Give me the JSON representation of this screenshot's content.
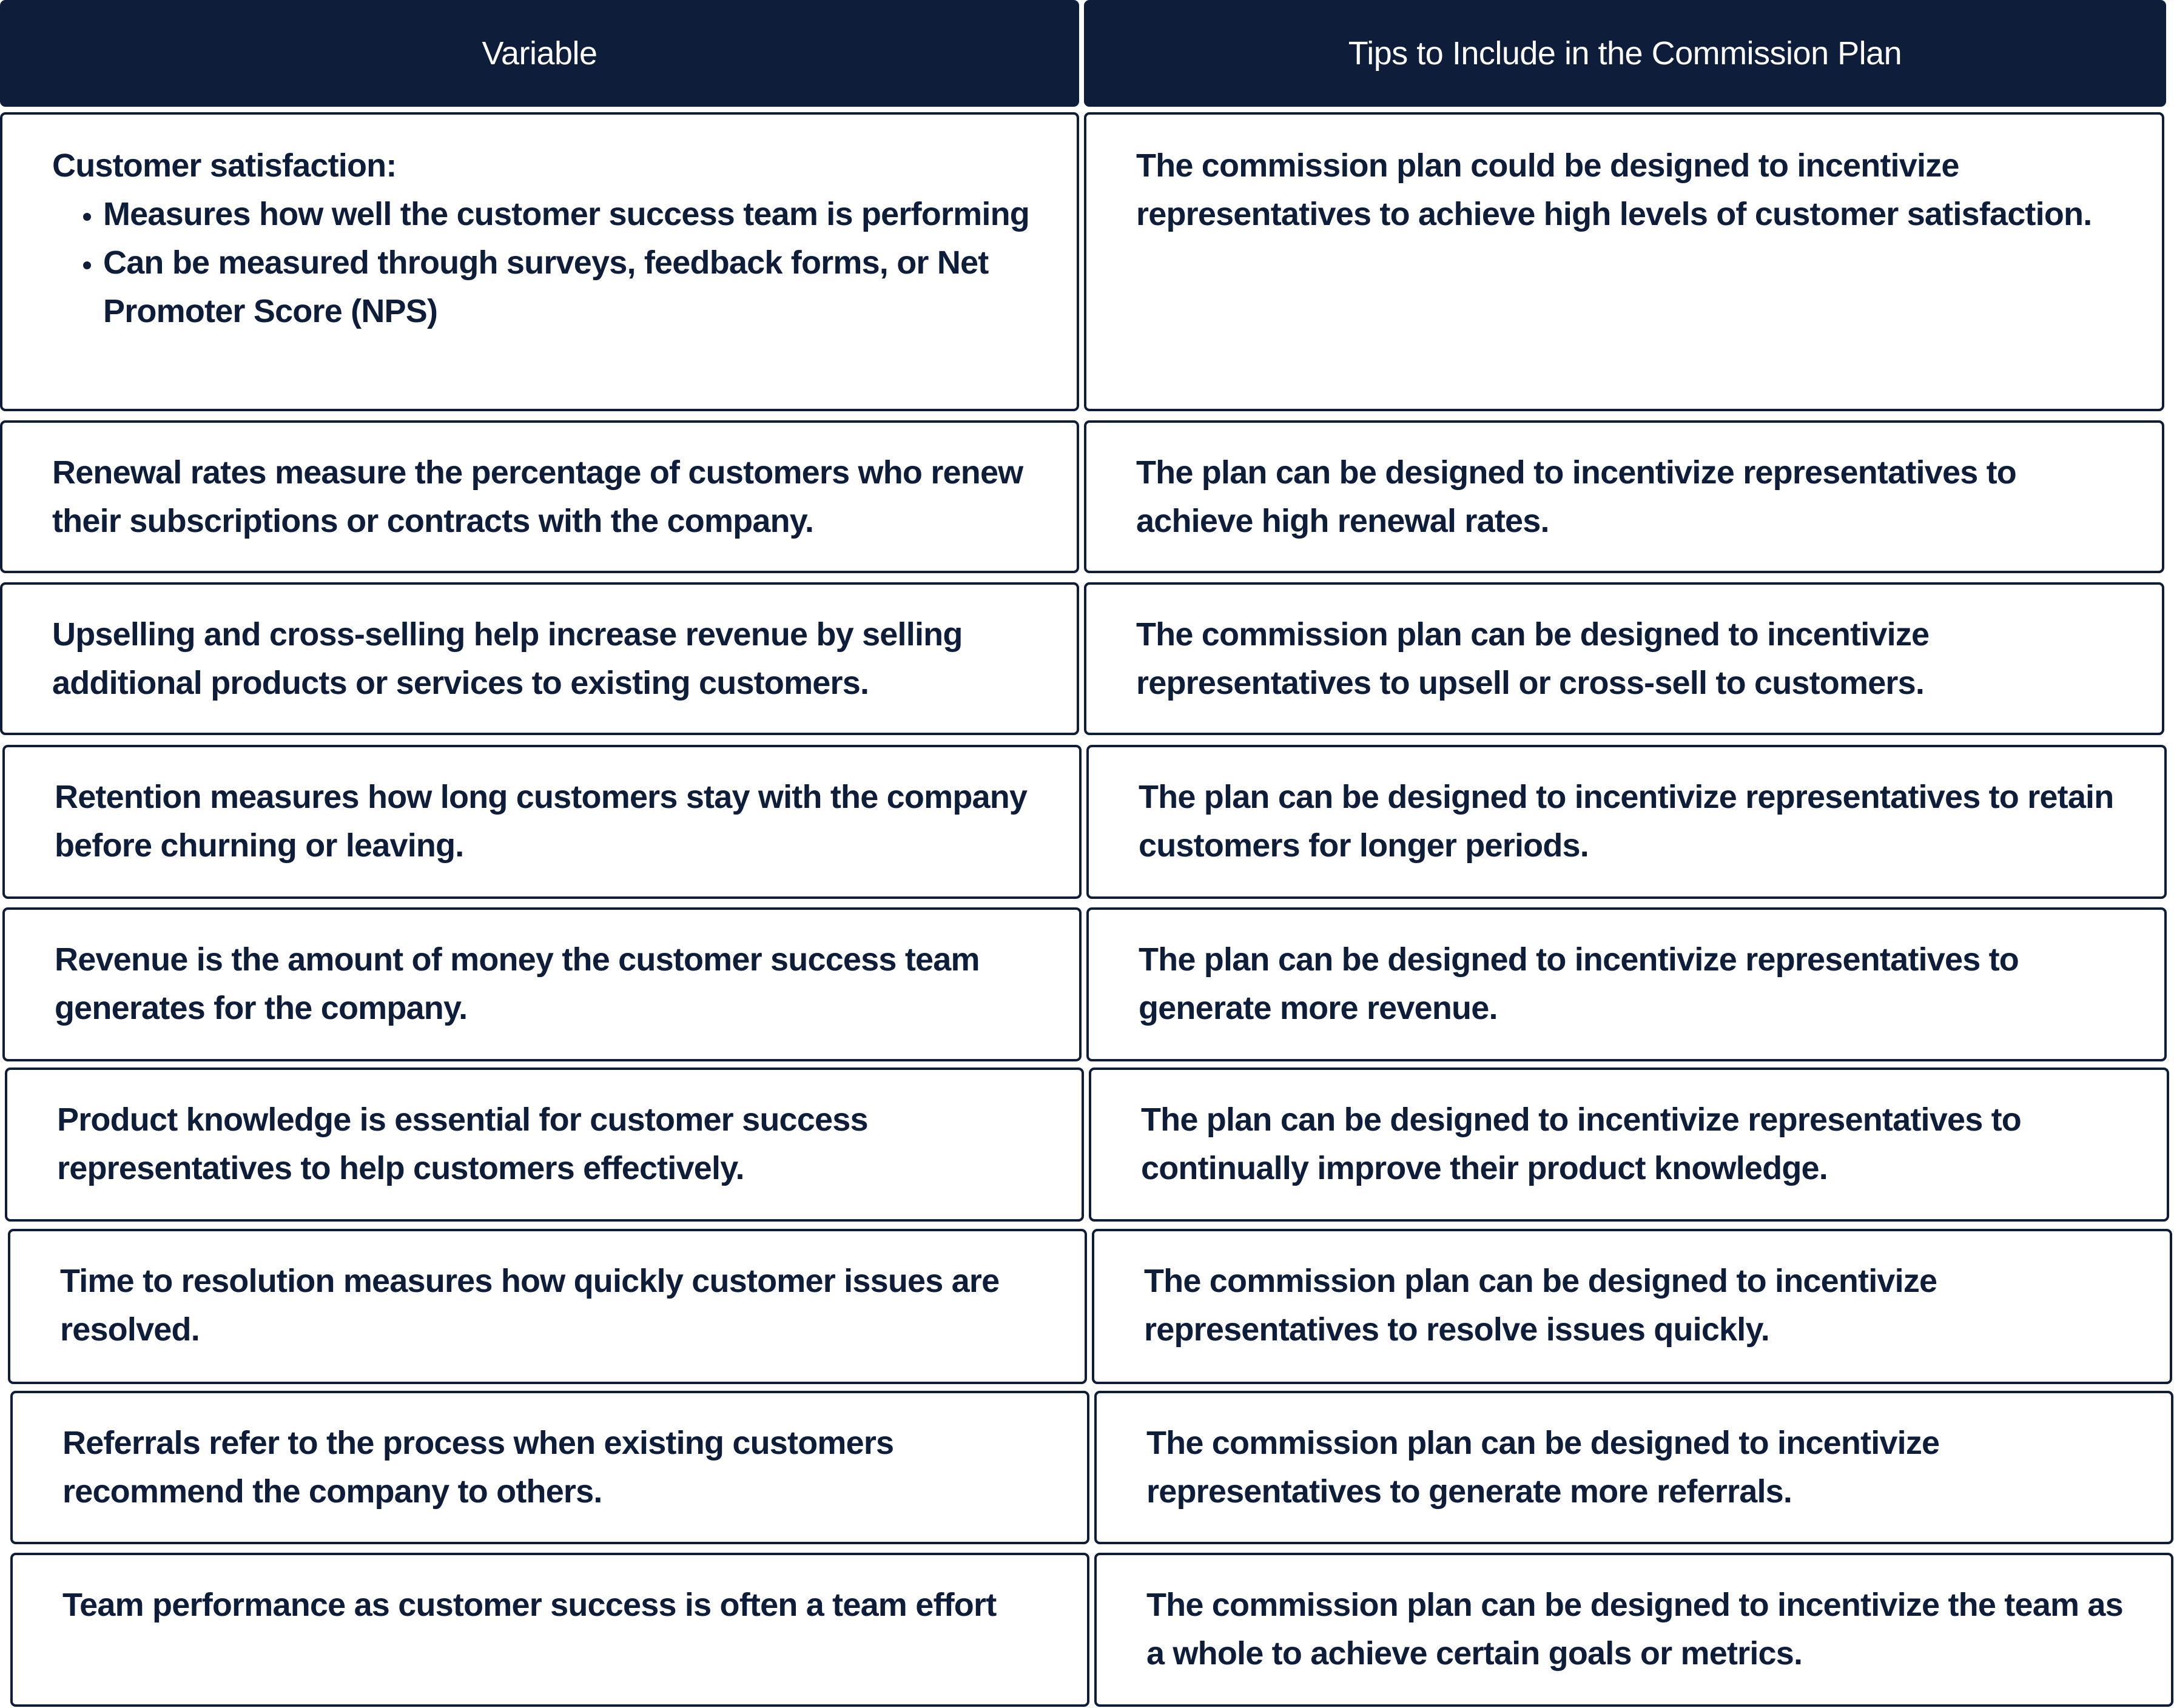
{
  "table": {
    "headers": [
      "Variable",
      "Tips to Include in the Commission Plan"
    ],
    "colors": {
      "header_bg": "#0e1e3a",
      "header_text": "#ffffff",
      "border": "#0e1e3a",
      "body_text": "#0e1e3a",
      "cell_bg": "#ffffff"
    },
    "rows": [
      {
        "variable": {
          "title": "Customer satisfaction:",
          "bullets": [
            "Measures how well the customer success team is performing",
            "Can be measured through surveys, feedback forms, or Net Promoter Score (NPS)"
          ]
        },
        "tip": "The commission plan could be designed to incentivize representatives to achieve high levels of customer satisfaction."
      },
      {
        "variable": "Renewal rates measure the percentage of customers who renew their subscriptions or contracts with the company.",
        "tip": "The plan can be designed to incentivize representatives to achieve high renewal rates."
      },
      {
        "variable": "Upselling and cross-selling help increase revenue by selling additional products or services to existing customers.",
        "tip": "The commission plan can be designed to incentivize representatives to upsell or cross-sell to customers."
      },
      {
        "variable": "Retention measures how long customers stay with the company before churning or leaving.",
        "tip": "The plan can be designed to incentivize representatives to retain customers for longer periods."
      },
      {
        "variable": "Revenue is the amount of money the customer success team generates for the company.",
        "tip": "The plan can be designed to incentivize representatives to generate more revenue."
      },
      {
        "variable": "Product knowledge is essential for customer success representatives to help customers effectively.",
        "tip": "The plan can be designed to incentivize representatives to continually improve their product knowledge."
      },
      {
        "variable": "Time to resolution measures how quickly customer issues are resolved.",
        "tip": "The commission plan can be designed to incentivize representatives to resolve issues quickly."
      },
      {
        "variable": "Referrals refer to the process when existing customers recommend the company to others.",
        "tip": "The commission plan can be designed to incentivize representatives to generate more referrals."
      },
      {
        "variable": "Team performance as customer success is often a team effort",
        "tip": "The commission plan can be designed to incentivize the team as a whole to achieve certain goals or metrics."
      }
    ]
  }
}
